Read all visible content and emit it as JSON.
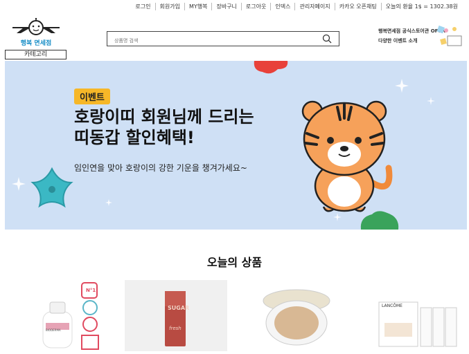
{
  "topnav": {
    "items": [
      "로그인",
      "회원가입",
      "MY행복",
      "장바구니",
      "로그아웃",
      "인덱스",
      "관리자페이지",
      "카카오 오픈채팅"
    ],
    "rate": "오늘의 환율 1$ = 1302.38원"
  },
  "logo": {
    "text": "행복 면세점"
  },
  "category_button": "카테고리",
  "search": {
    "placeholder": "상품명 검색"
  },
  "promo": {
    "line1": "행복면세점 공식스토어관 OPEN",
    "line2": "다양한 이벤트 소개"
  },
  "banner": {
    "badge": "이벤트",
    "headline_line1": "호랑이띠 회원님께 드리는",
    "headline_line2": "띠동갑 할인혜택!",
    "subline": "임인연을 맞아 호랑이의 강한 기운을 챙겨가세요~",
    "bg_color": "#cfe0f5",
    "badge_color": "#f6b728"
  },
  "section_title": "오늘의 상품",
  "products": [
    {
      "label_top": "N°1",
      "brand": "BIODERMA"
    },
    {
      "label_top": "SUGAR",
      "brand": "fresh"
    },
    {
      "label_top": "",
      "brand": ""
    },
    {
      "label_top": "",
      "brand": "LANCÔME"
    }
  ]
}
